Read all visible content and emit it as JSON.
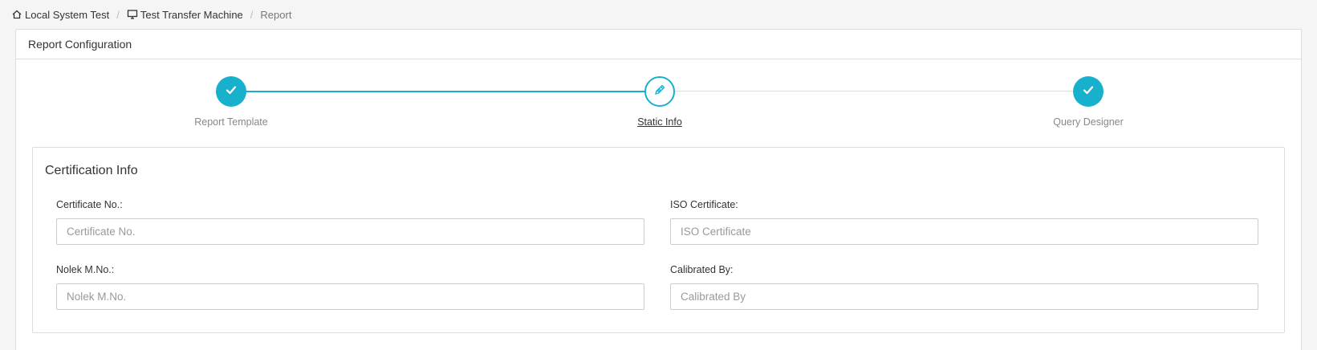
{
  "breadcrumb": {
    "items": [
      {
        "label": "Local System Test",
        "icon": "home-icon"
      },
      {
        "label": "Test Transfer Machine",
        "icon": "monitor-icon"
      },
      {
        "label": "Report"
      }
    ],
    "separator": "/"
  },
  "panel": {
    "title": "Report Configuration"
  },
  "stepper": {
    "accent_color": "#17b1cd",
    "steps": [
      {
        "label": "Report Template",
        "state": "done",
        "icon": "check-icon"
      },
      {
        "label": "Static Info",
        "state": "current",
        "icon": "pencil-icon"
      },
      {
        "label": "Query Designer",
        "state": "done",
        "icon": "check-icon"
      }
    ]
  },
  "certification": {
    "title": "Certification Info",
    "fields": {
      "certificate_no": {
        "label": "Certificate No.:",
        "placeholder": "Certificate No.",
        "value": ""
      },
      "iso_certificate": {
        "label": "ISO Certificate:",
        "placeholder": "ISO Certificate",
        "value": ""
      },
      "nolek_mno": {
        "label": "Nolek M.No.:",
        "placeholder": "Nolek M.No.",
        "value": ""
      },
      "calibrated_by": {
        "label": "Calibrated By:",
        "placeholder": "Calibrated By",
        "value": ""
      }
    }
  }
}
